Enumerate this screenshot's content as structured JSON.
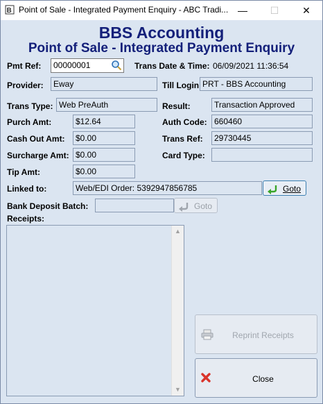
{
  "window": {
    "title": "Point of Sale - Integrated Payment Enquiry - ABC Tradi...",
    "minimize_label": "—",
    "maximize_label": "☐",
    "close_label": "✕"
  },
  "header": {
    "company": "BBS Accounting",
    "subtitle": "Point of Sale - Integrated Payment Enquiry"
  },
  "form": {
    "pmt_ref_label": "Pmt Ref:",
    "pmt_ref_value": "00000001",
    "trans_datetime_label": "Trans Date & Time:",
    "trans_datetime_value": "06/09/2021 11:36:54",
    "provider_label": "Provider:",
    "provider_value": "Eway",
    "till_login_label": "Till Login:",
    "till_login_value": "PRT - BBS Accounting",
    "trans_type_label": "Trans Type:",
    "trans_type_value": "Web PreAuth",
    "result_label": "Result:",
    "result_value": "Transaction Approved",
    "purch_amt_label": "Purch Amt:",
    "purch_amt_value": "$12.64",
    "auth_code_label": "Auth Code:",
    "auth_code_value": "660460",
    "cash_out_label": "Cash Out Amt:",
    "cash_out_value": "$0.00",
    "trans_ref_label": "Trans Ref:",
    "trans_ref_value": "29730445",
    "surcharge_label": "Surcharge Amt:",
    "surcharge_value": "$0.00",
    "card_type_label": "Card Type:",
    "card_type_value": "",
    "tip_label": "Tip Amt:",
    "tip_value": "$0.00",
    "linked_label": "Linked to:",
    "linked_value": "Web/EDI Order: 5392947856785",
    "linked_goto_label": "Goto",
    "bank_batch_label": "Bank Deposit Batch:",
    "bank_batch_value": "",
    "bank_goto_label": "Goto",
    "receipts_label": "Receipts:"
  },
  "buttons": {
    "reprint_label": "Reprint Receipts",
    "close_label": "Close"
  },
  "colors": {
    "background": "#dbe5f1",
    "heading": "#14207a",
    "close_icon": "#d9342b",
    "goto_icon": "#3aa52a"
  }
}
